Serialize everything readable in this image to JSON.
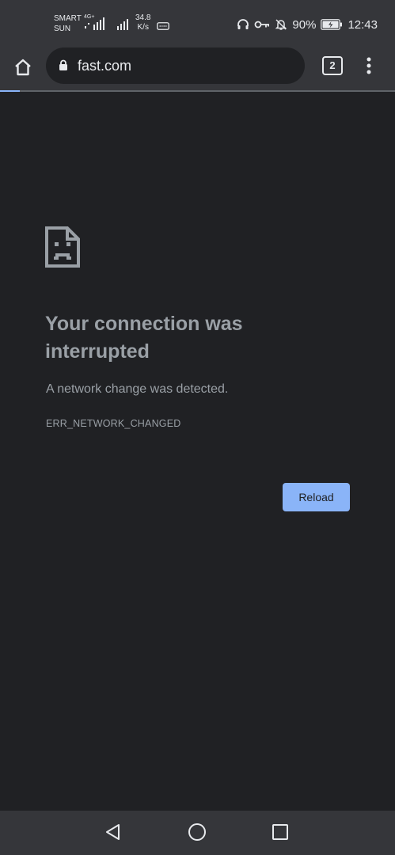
{
  "status_bar": {
    "carrier_line1": "SMART",
    "carrier_line2": "SUN",
    "network_type": "4G+",
    "speed_value": "34.8",
    "speed_unit": "K/s",
    "battery_percent": "90%",
    "time": "12:43",
    "icons": [
      "signal-icon",
      "signal-icon",
      "sms-icon",
      "headphones-icon",
      "vpn-key-icon",
      "bell-off-icon",
      "battery-charging-icon"
    ]
  },
  "toolbar": {
    "url": "fast.com",
    "tab_count": "2",
    "icons": [
      "home-icon",
      "lock-icon",
      "overflow-menu-icon"
    ]
  },
  "progress": {
    "fraction": 0.05,
    "color": "#8ab4f8"
  },
  "error": {
    "title": "Your connection was interrupted",
    "description": "A network change was detected.",
    "code": "ERR_NETWORK_CHANGED",
    "reload_label": "Reload",
    "icon": "sad-page-icon"
  },
  "nav_bar": {
    "icons": [
      "back-triangle-icon",
      "home-circle-icon",
      "recents-square-icon"
    ]
  },
  "colors": {
    "background": "#202124",
    "toolbar": "#35363a",
    "accent": "#8ab4f8",
    "text_secondary": "#9aa0a6"
  }
}
